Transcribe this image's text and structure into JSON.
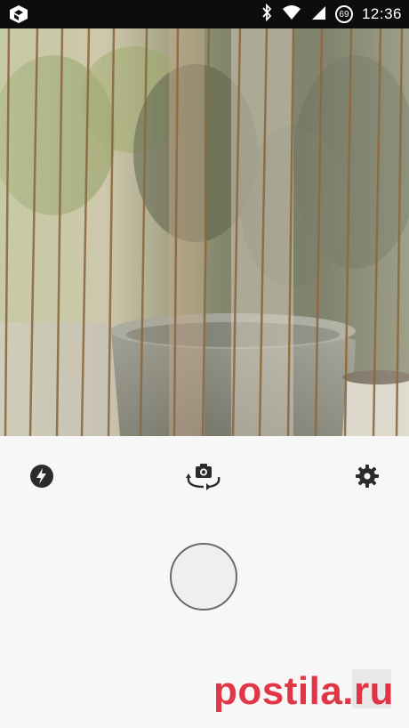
{
  "status_bar": {
    "time": "12:36",
    "battery_level": "69",
    "icons": [
      "app-logo-icon",
      "bluetooth-icon",
      "wifi-icon",
      "signal-icon",
      "battery-icon"
    ]
  },
  "viewfinder": {
    "scene": "camera-preview"
  },
  "controls": {
    "flash_icon": "flash-auto-icon",
    "switch_camera_icon": "switch-camera-icon",
    "settings_icon": "gear-icon",
    "shutter": "shutter-button"
  },
  "watermark": {
    "text": "postila.ru"
  },
  "colors": {
    "status_bar_bg": "#0d0d0d",
    "controls_bg": "#f7f7f7",
    "icon_color": "#2b2b2b",
    "watermark_red": "#dc1428"
  }
}
